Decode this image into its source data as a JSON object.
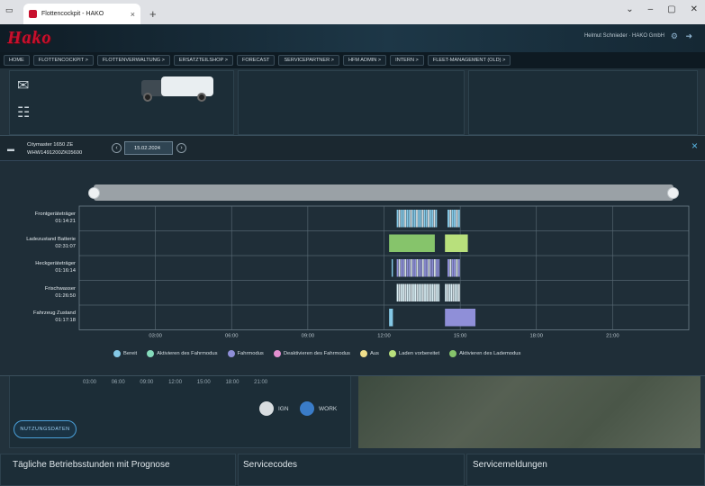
{
  "browser": {
    "tab_title": "Flottencockpit - HAKO",
    "tab_close": "×",
    "new_tab": "+"
  },
  "header": {
    "logo": "Hako",
    "user": "Helmut Schnieder · HAKO GmbH"
  },
  "nav": {
    "items": [
      "HOME",
      "FLOTTENCOCKPIT >",
      "FLOTTENVERWALTUNG >",
      "ERSATZTEILSHOP >",
      "FORECAST",
      "SERVICEPARTNER >",
      "HFM ADMIN >",
      "INTERN >",
      "FLEET-MANAGEMENT (OLD) >"
    ]
  },
  "dashboard": {
    "hour_labels": [
      "03:00",
      "06:00",
      "09:00",
      "12:00",
      "15:00",
      "18:00",
      "21:00"
    ],
    "ign_label": "IGN",
    "work_label": "WORK",
    "nutzungsdaten_button": "NUTZUNGSDATEN",
    "bottom_titles": [
      "Tägliche Betriebsstunden mit Prognose",
      "Servicecodes",
      "Servicemeldungen"
    ]
  },
  "modal": {
    "vehicle_name": "Citymaster 1650 ZE",
    "vehicle_id": "WHW1491200ZK05600",
    "date": "15.02.2024",
    "prev": "‹",
    "next": "›",
    "close": "×"
  },
  "colors": {
    "bereit": "#84c8e6",
    "aktivieren_fahrmodus": "#86dcbc",
    "fahrmodus": "#8f8fd8",
    "deaktivieren_fahrmodus": "#e38fd0",
    "aus": "#f1e08c",
    "laden_vorbereitet": "#b8e07c",
    "aktivieren_lademodus": "#86c46b",
    "light": "#d8ecf2"
  },
  "chart_data": {
    "type": "timeline",
    "xlabel": "",
    "ylabel": "",
    "x_unit": "hour of day",
    "xlim": [
      0,
      24
    ],
    "x_ticks": [
      3,
      6,
      9,
      12,
      15,
      18,
      21
    ],
    "x_tick_labels": [
      "03:00",
      "06:00",
      "09:00",
      "12:00",
      "15:00",
      "18:00",
      "21:00"
    ],
    "rows": [
      {
        "label": "Frontgeräteträger",
        "duration": "01:14:21",
        "segments": [
          {
            "start": 12.5,
            "end": 14.1,
            "state": "bereit",
            "shade": "striped"
          },
          {
            "start": 14.5,
            "end": 15.0,
            "state": "bereit",
            "shade": "striped"
          }
        ]
      },
      {
        "label": "Ladezustand Batterie",
        "duration": "02:31:07",
        "segments": [
          {
            "start": 12.2,
            "end": 14.0,
            "state": "aktivieren_lademodus"
          },
          {
            "start": 14.4,
            "end": 15.3,
            "state": "laden_vorbereitet"
          }
        ]
      },
      {
        "label": "Heckgeräteträger",
        "duration": "01:16:14",
        "segments": [
          {
            "start": 12.3,
            "end": 12.35,
            "state": "bereit"
          },
          {
            "start": 12.5,
            "end": 14.2,
            "state": "fahrmodus",
            "shade": "striped"
          },
          {
            "start": 14.5,
            "end": 15.0,
            "state": "fahrmodus",
            "shade": "striped"
          }
        ]
      },
      {
        "label": "Frischwasser",
        "duration": "01:26:50",
        "segments": [
          {
            "start": 12.5,
            "end": 14.2,
            "state": "light",
            "shade": "striped"
          },
          {
            "start": 14.4,
            "end": 15.0,
            "state": "light",
            "shade": "striped"
          }
        ]
      },
      {
        "label": "Fahrzeug Zustand",
        "duration": "01:17:18",
        "segments": [
          {
            "start": 12.2,
            "end": 12.35,
            "state": "bereit"
          },
          {
            "start": 14.4,
            "end": 15.6,
            "state": "fahrmodus"
          }
        ]
      }
    ],
    "legend": [
      {
        "key": "bereit",
        "label": "Bereit"
      },
      {
        "key": "aktivieren_fahrmodus",
        "label": "Aktivieren des Fahrmodus"
      },
      {
        "key": "fahrmodus",
        "label": "Fahrmodus"
      },
      {
        "key": "deaktivieren_fahrmodus",
        "label": "Deaktivieren des Fahrmodus"
      },
      {
        "key": "aus",
        "label": "Aus"
      },
      {
        "key": "laden_vorbereitet",
        "label": "Laden vorbereitet"
      },
      {
        "key": "aktivieren_lademodus",
        "label": "Aktivieren des Lademodus"
      }
    ]
  }
}
